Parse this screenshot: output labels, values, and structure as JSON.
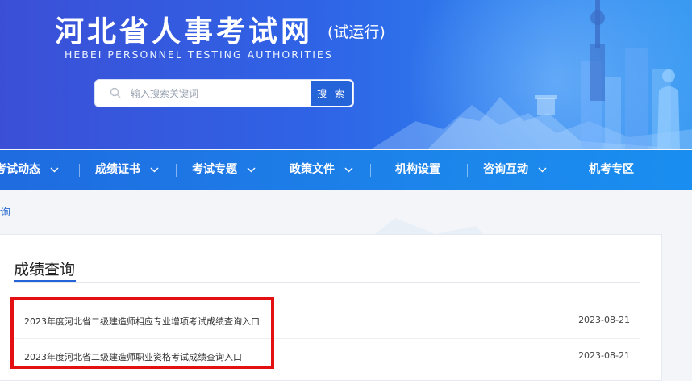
{
  "header": {
    "title": "河北省人事考试网",
    "title_tag": "(试运行)",
    "subtitle_en": "HEBEI PERSONNEL TESTING AUTHORITIES",
    "search": {
      "placeholder": "输入搜索关键词",
      "button_label": "搜 索"
    }
  },
  "nav": {
    "items": [
      {
        "label": "考试动态",
        "has_dropdown": true
      },
      {
        "label": "成绩证书",
        "has_dropdown": true
      },
      {
        "label": "考试专题",
        "has_dropdown": true
      },
      {
        "label": "政策文件",
        "has_dropdown": true
      },
      {
        "label": "机构设置",
        "has_dropdown": false
      },
      {
        "label": "咨询互动",
        "has_dropdown": true
      },
      {
        "label": "机考专区",
        "has_dropdown": false
      }
    ]
  },
  "breadcrumb": {
    "text": "询"
  },
  "main": {
    "section_title": "成绩查询",
    "list": [
      {
        "title": "2023年度河北省二级建造师相应专业增项考试成绩查询入口",
        "date": "2023-08-21"
      },
      {
        "title": "2023年度河北省二级建造师职业资格考试成绩查询入口",
        "date": "2023-08-21"
      }
    ]
  },
  "colors": {
    "accent": "#2563d9",
    "nav_bg": "#1c84ea",
    "highlight": "#e40f12"
  }
}
